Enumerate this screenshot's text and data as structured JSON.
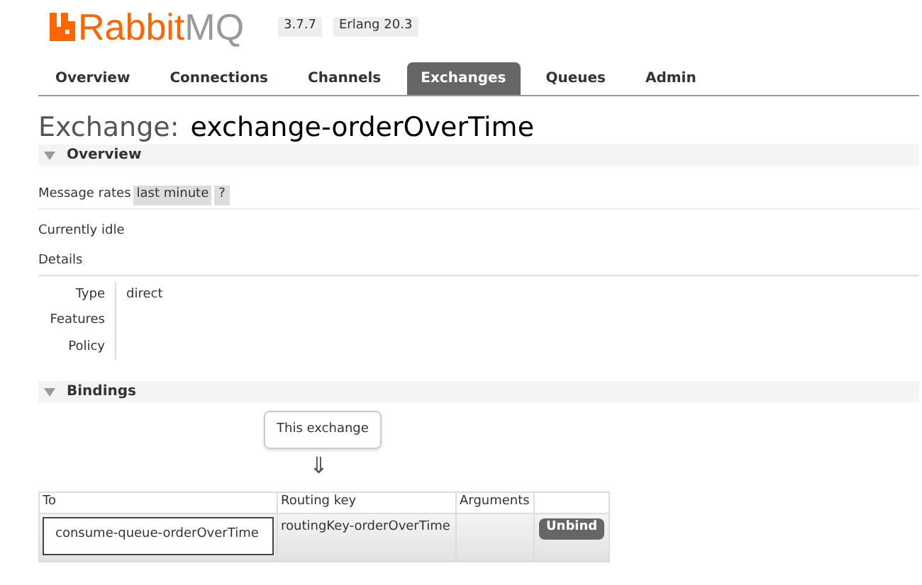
{
  "header": {
    "logo_primary": "Rabbit",
    "logo_secondary": "MQ",
    "version": "3.7.7",
    "erlang": "Erlang 20.3"
  },
  "tabs": [
    {
      "label": "Overview",
      "selected": false
    },
    {
      "label": "Connections",
      "selected": false
    },
    {
      "label": "Channels",
      "selected": false
    },
    {
      "label": "Exchanges",
      "selected": true
    },
    {
      "label": "Queues",
      "selected": false
    },
    {
      "label": "Admin",
      "selected": false
    }
  ],
  "title": {
    "prefix": "Exchange:",
    "name": "exchange-orderOverTime"
  },
  "overview": {
    "heading": "Overview",
    "expanded": true,
    "rates_label": "Message rates",
    "rates_value": "last minute",
    "help": "?",
    "status": "Currently idle",
    "details_label": "Details",
    "details": [
      {
        "label": "Type",
        "value": "direct"
      },
      {
        "label": "Features"
      },
      {
        "label": "Policy"
      }
    ]
  },
  "bindings": {
    "heading": "Bindings",
    "expanded": true,
    "source": "This exchange",
    "arrow": "⇓",
    "columns": [
      "To",
      "Routing key",
      "Arguments"
    ],
    "rows": [
      {
        "to": "consume-queue-orderOverTime",
        "routing_key": "routingKey-orderOverTime",
        "action": "Unbind"
      }
    ]
  }
}
